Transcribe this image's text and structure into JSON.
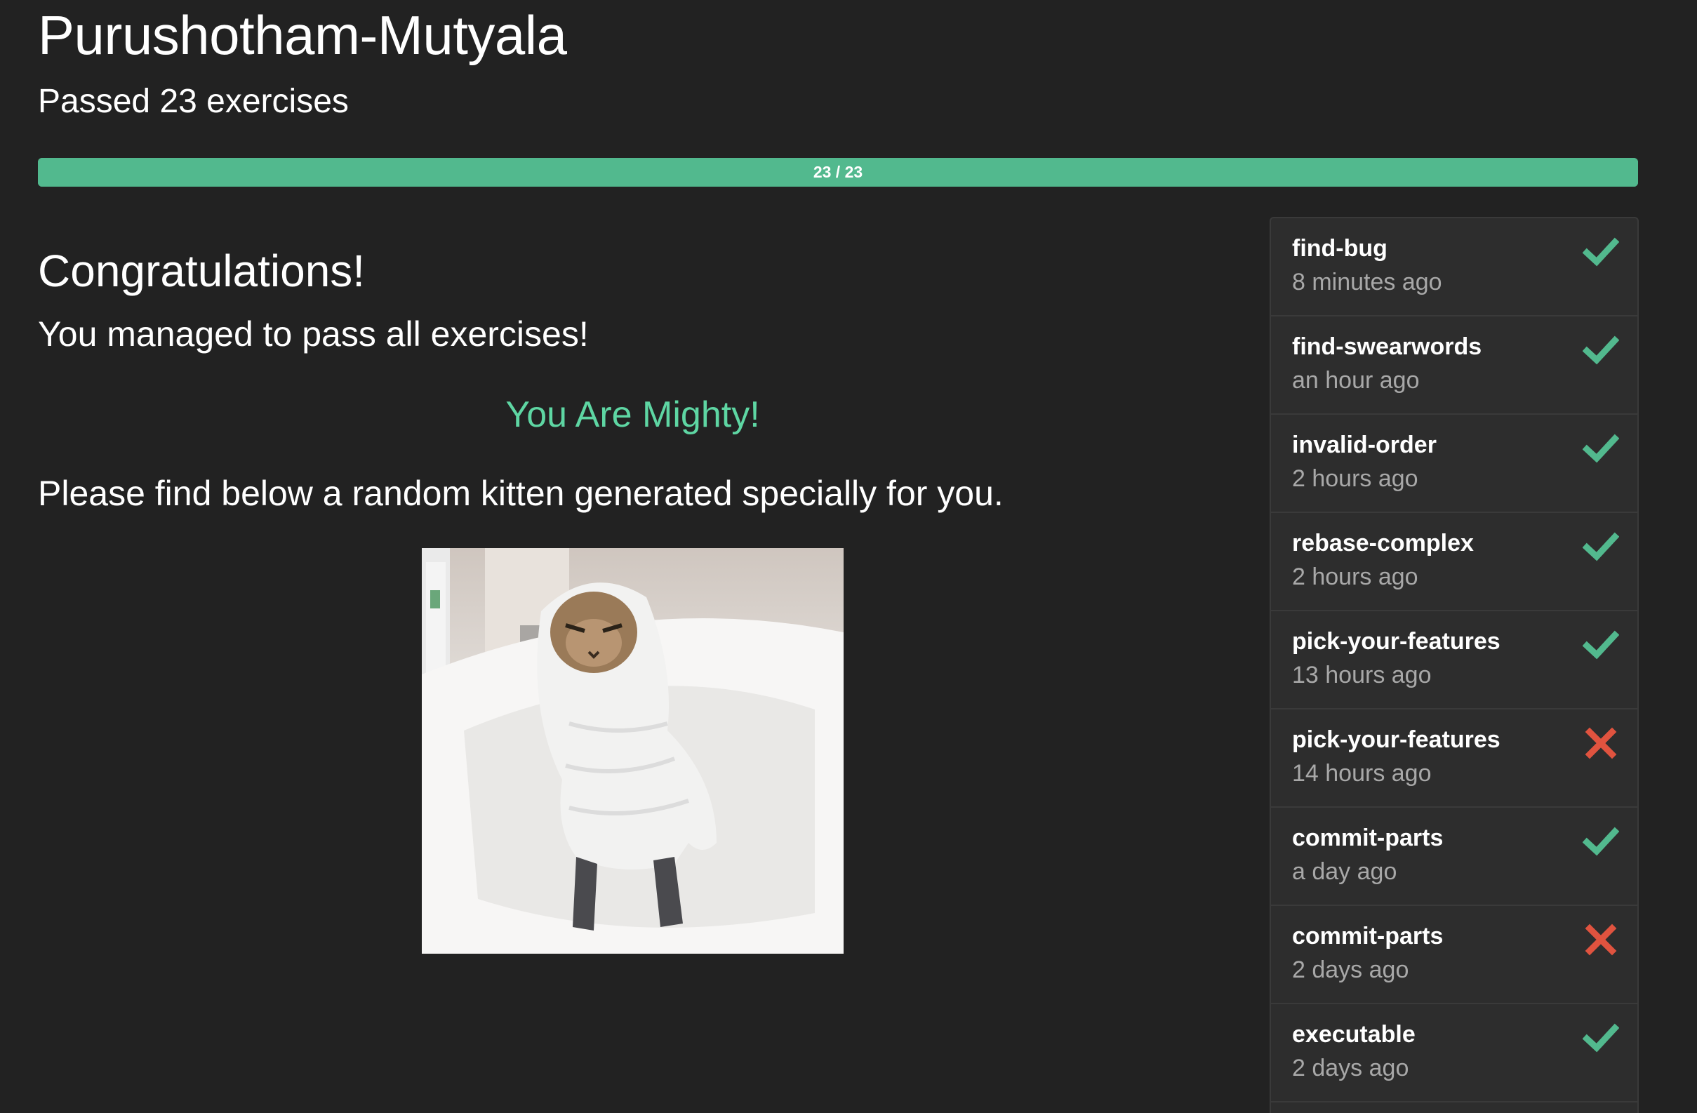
{
  "header": {
    "username": "Purushotham-Mutyala",
    "passed_text": "Passed 23 exercises"
  },
  "progress": {
    "label": "23 / 23",
    "completed": 23,
    "total": 23,
    "fraction": 1.0,
    "color": "#52b98e"
  },
  "main": {
    "title": "Congratulations!",
    "message": "You managed to pass all exercises!",
    "mighty": "You Are Mighty!",
    "kitten_text": "Please find below a random kitten generated specially for you."
  },
  "colors": {
    "background": "#222222",
    "accent": "#5ed6a3",
    "success": "#52b98e",
    "failure": "#e0533f"
  },
  "exercises": [
    {
      "name": "find-bug",
      "time": "8 minutes ago",
      "status": "passed",
      "icon": "check-icon"
    },
    {
      "name": "find-swearwords",
      "time": "an hour ago",
      "status": "passed",
      "icon": "check-icon"
    },
    {
      "name": "invalid-order",
      "time": "2 hours ago",
      "status": "passed",
      "icon": "check-icon"
    },
    {
      "name": "rebase-complex",
      "time": "2 hours ago",
      "status": "passed",
      "icon": "check-icon"
    },
    {
      "name": "pick-your-features",
      "time": "13 hours ago",
      "status": "passed",
      "icon": "check-icon"
    },
    {
      "name": "pick-your-features",
      "time": "14 hours ago",
      "status": "failed",
      "icon": "cross-icon"
    },
    {
      "name": "commit-parts",
      "time": "a day ago",
      "status": "passed",
      "icon": "check-icon"
    },
    {
      "name": "commit-parts",
      "time": "2 days ago",
      "status": "failed",
      "icon": "cross-icon"
    },
    {
      "name": "executable",
      "time": "2 days ago",
      "status": "passed",
      "icon": "check-icon"
    }
  ]
}
